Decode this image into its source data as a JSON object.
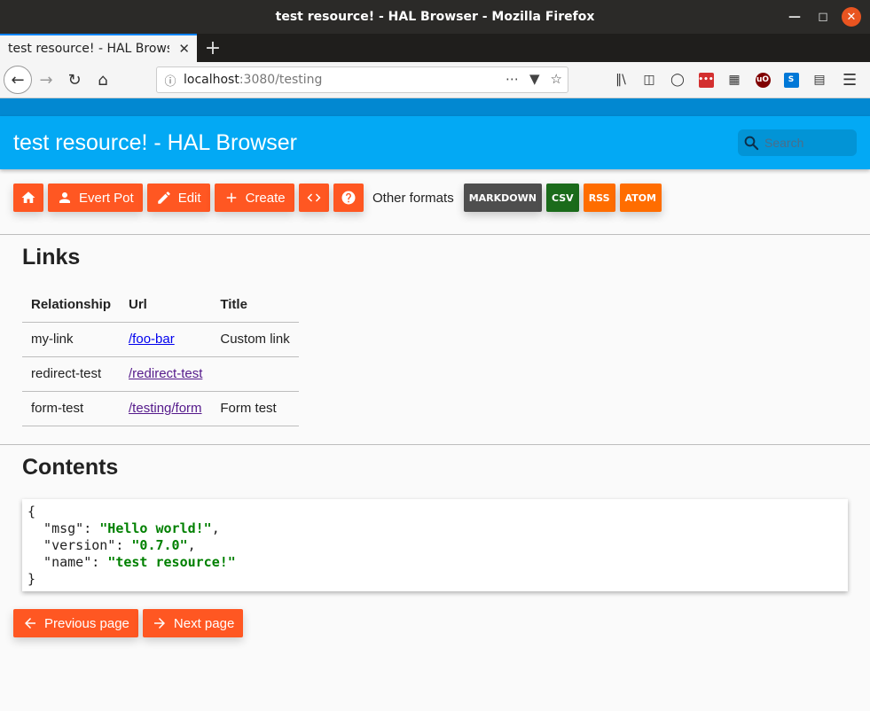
{
  "window": {
    "title": "test resource! - HAL Browser - Mozilla Firefox"
  },
  "browser": {
    "tab_title": "test resource! - HAL Browser",
    "url_host": "localhost",
    "url_path": ":3080/testing"
  },
  "app": {
    "title": "test resource! - HAL Browser",
    "search_placeholder": "Search"
  },
  "actions": {
    "user_label": "Evert Pot",
    "edit_label": "Edit",
    "create_label": "Create"
  },
  "formats": {
    "label": "Other formats",
    "items": [
      {
        "label": "MARKDOWN",
        "color": "#4e4e4e"
      },
      {
        "label": "CSV",
        "color": "#1b6b1b"
      },
      {
        "label": "RSS",
        "color": "#ff6d00"
      },
      {
        "label": "ATOM",
        "color": "#ff6d00"
      }
    ]
  },
  "links": {
    "heading": "Links",
    "columns": [
      "Relationship",
      "Url",
      "Title"
    ],
    "rows": [
      {
        "rel": "my-link",
        "url": "/foo-bar",
        "title": "Custom link"
      },
      {
        "rel": "redirect-test",
        "url": "/redirect-test",
        "title": ""
      },
      {
        "rel": "form-test",
        "url": "/testing/form",
        "title": "Form test"
      }
    ]
  },
  "contents": {
    "heading": "Contents",
    "json": {
      "open": "{",
      "msg_key": "  \"msg\": ",
      "msg_val": "\"Hello world!\"",
      "version_key": "  \"version\": ",
      "version_val": "\"0.7.0\"",
      "name_key": "  \"name\": ",
      "name_val": "\"test resource!\"",
      "close": "}"
    }
  },
  "pager": {
    "prev_label": "Previous page",
    "next_label": "Next page"
  },
  "colors": {
    "accent": "#ff5722",
    "header": "#03a9f4",
    "header_strip": "#0288d1"
  }
}
